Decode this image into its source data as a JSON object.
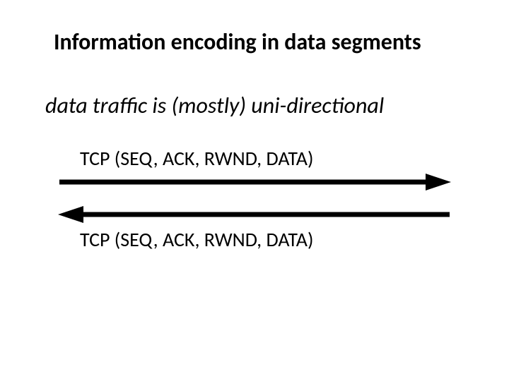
{
  "title": "Information encoding in data segments",
  "subtitle": "data traffic is (mostly) uni-directional",
  "arrow_top_label": "TCP (SEQ, ACK, RWND, DATA)",
  "arrow_bottom_label": "TCP (SEQ, ACK, RWND, DATA)",
  "chart_data": {
    "type": "diagram",
    "description": "Two horizontal arrows showing bidirectional TCP segment exchange",
    "arrows": [
      {
        "direction": "right",
        "label": "TCP (SEQ, ACK, RWND, DATA)"
      },
      {
        "direction": "left",
        "label": "TCP (SEQ, ACK, RWND, DATA)"
      }
    ]
  }
}
